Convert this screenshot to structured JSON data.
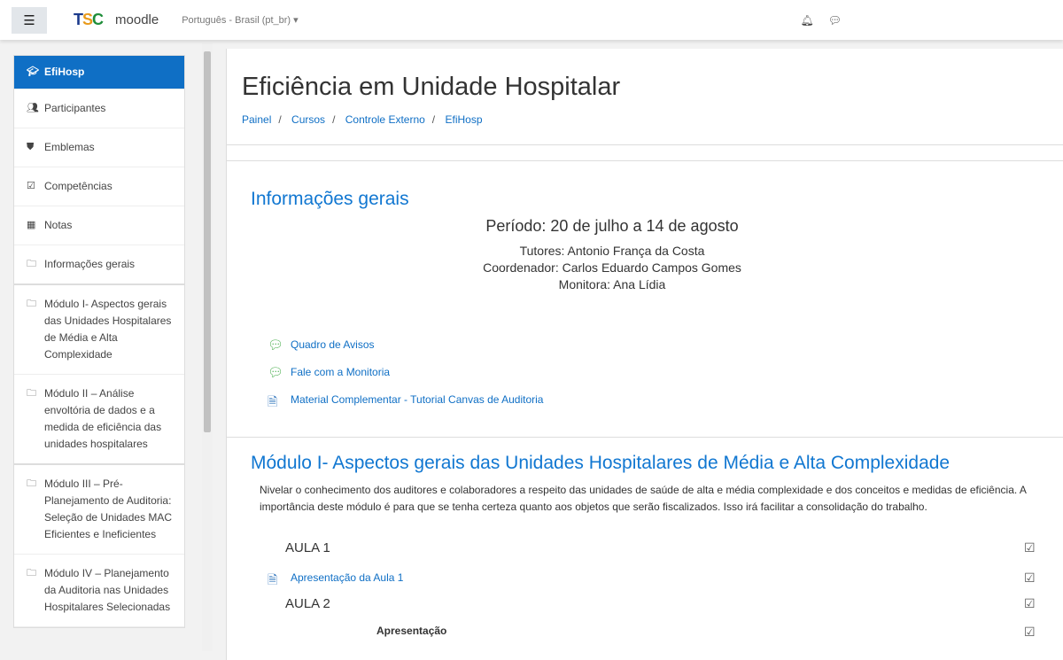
{
  "navbar": {
    "logo": "TSC",
    "brand": "moodle",
    "language": "Português - Brasil (pt_br) ▾",
    "bell_icon": "bell-icon",
    "chat_icon": "chat-icon"
  },
  "sidebar": {
    "items": [
      {
        "label": "EfiHosp",
        "icon": "graduation-cap-icon"
      },
      {
        "label": "Participantes",
        "icon": "users-icon"
      },
      {
        "label": "Emblemas",
        "icon": "shield-icon"
      },
      {
        "label": "Competências",
        "icon": "checkbox-icon"
      },
      {
        "label": "Notas",
        "icon": "table-icon"
      },
      {
        "label": "Informações gerais",
        "icon": "folder-icon"
      },
      {
        "label": "Módulo I- Aspectos gerais das Unidades Hospitalares de Média e Alta Complexidade",
        "icon": "folder-icon"
      },
      {
        "label": "Módulo II – Análise envoltória de dados e a medida de eficiência das unidades hospitalares",
        "icon": "folder-icon"
      },
      {
        "label": "Módulo III – Pré-Planejamento de Auditoria: Seleção de Unidades MAC Eficientes e Ineficientes",
        "icon": "folder-icon"
      },
      {
        "label": "Módulo IV – Planejamento da Auditoria nas Unidades Hospitalares Selecionadas",
        "icon": "folder-icon"
      }
    ]
  },
  "page": {
    "title": "Eficiência em Unidade Hospitalar",
    "breadcrumb": [
      "Painel",
      "Cursos",
      "Controle Externo",
      "EfiHosp"
    ]
  },
  "general": {
    "title": "Informações gerais",
    "period": "Período: 20 de julho a 14 de agosto",
    "tutors": "Tutores: Antonio França da Costa",
    "coordinator": "Coordenador: Carlos Eduardo Campos Gomes",
    "monitor": "Monitora: Ana Lídia",
    "activities": [
      {
        "label": "Quadro de Avisos",
        "icon": "forum-icon"
      },
      {
        "label": "Fale com a Monitoria",
        "icon": "forum-icon"
      },
      {
        "label": "Material Complementar - Tutorial Canvas de Auditoria",
        "icon": "file-icon"
      }
    ]
  },
  "module1": {
    "title": "Módulo I- Aspectos gerais das Unidades Hospitalares de Média e Alta Complexidade",
    "description": "Nivelar o conhecimento dos auditores e colaboradores a respeito das unidades de saúde de alta e média complexidade e dos conceitos e medidas de eficiência. A importância deste módulo é para que se tenha certeza quanto aos objetos que serão fiscalizados. Isso irá facilitar a consolidação do trabalho.",
    "items": [
      "AULA 1",
      "Apresentação da Aula 1",
      "AULA 2",
      "Apresentação"
    ]
  }
}
